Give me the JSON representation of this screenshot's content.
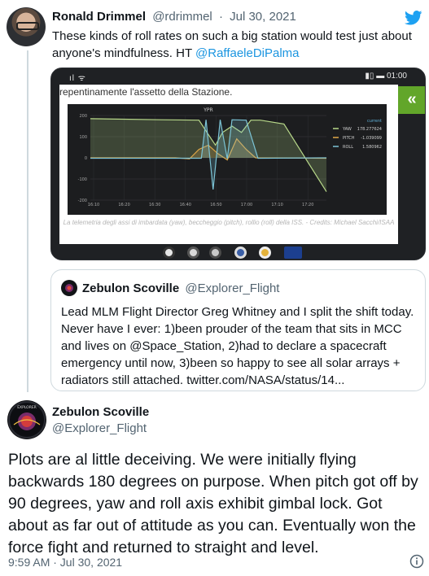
{
  "reply_tweet": {
    "author_name": "Ronald Drimmel",
    "handle": "@rdrimmel",
    "separator": "·",
    "date": "Jul 30, 2021",
    "text_before": "These kinds of roll rates on such a big station would test just about anyone's mindfulness. HT ",
    "mention": "@RaffaeleDiPalma",
    "icons": {
      "avatar": "avatar",
      "platform": "bird-icon"
    },
    "media": {
      "status_left": "ıl ᯤ",
      "status_right": "▮▯ ▬ 01:00",
      "page_text": "repentinamente l'assetto della Stazione.",
      "caption": "La telemetria degli assi di imbardata (yaw), beccheggio (pitch), rollio (roll) della ISS. - Credits: Michael Sacchi/ISAA",
      "nav_button": "«",
      "chart_data": {
        "type": "line",
        "title": "YPR",
        "x": [
          "16:10",
          "16:20",
          "16:30",
          "16:40",
          "16:50",
          "17:00",
          "17:10",
          "17:20"
        ],
        "ylim": [
          -200,
          200
        ],
        "yticks": [
          "200",
          "100",
          "0",
          "-100",
          "-200"
        ],
        "legend_header": "current",
        "legend_position": "right",
        "series": [
          {
            "name": "YAW",
            "current": "178.277624",
            "color": "#b8d98a",
            "points": [
              [
                0,
                185
              ],
              [
                0.3,
                180
              ],
              [
                0.46,
                178
              ],
              [
                0.5,
                110
              ],
              [
                0.53,
                60
              ],
              [
                0.56,
                120
              ],
              [
                0.6,
                150
              ],
              [
                0.64,
                120
              ],
              [
                0.68,
                178
              ],
              [
                0.72,
                178
              ],
              [
                0.82,
                160
              ],
              [
                1,
                -160
              ]
            ]
          },
          {
            "name": "PITCH",
            "current": "-1.039099",
            "color": "#e0a848",
            "points": [
              [
                0,
                0
              ],
              [
                0.36,
                0
              ],
              [
                0.42,
                -5
              ],
              [
                0.46,
                40
              ],
              [
                0.5,
                60
              ],
              [
                0.54,
                20
              ],
              [
                0.58,
                -10
              ],
              [
                0.62,
                90
              ],
              [
                0.66,
                40
              ],
              [
                0.7,
                0
              ],
              [
                1,
                -2
              ]
            ]
          },
          {
            "name": "ROLL",
            "current": "1.580962",
            "color": "#7cc4d6",
            "points": [
              [
                0,
                -2
              ],
              [
                0.47,
                -2
              ],
              [
                0.49,
                180
              ],
              [
                0.52,
                -150
              ],
              [
                0.55,
                180
              ],
              [
                0.58,
                -5
              ],
              [
                0.6,
                180
              ],
              [
                0.66,
                178
              ],
              [
                0.71,
                -2
              ],
              [
                1,
                0
              ]
            ]
          }
        ]
      },
      "bottom_icons": [
        "nasa-logo-icon",
        "agency-patch-icon",
        "crew-patch-icon",
        "mission-patch-icon",
        "esa-patch-icon",
        "flag-icon"
      ]
    }
  },
  "quoted_tweet": {
    "author_name": "Zebulon Scoville",
    "handle": "@Explorer_Flight",
    "text": "Lead MLM Flight Director Greg Whitney and I split the shift today. Never have I ever: 1)been prouder of the team that sits in MCC and lives on @Space_Station, 2)had to declare a spacecraft emergency until now, 3)been so happy to see all solar arrays + radiators still attached. twitter.com/NASA/status/14..."
  },
  "main_tweet": {
    "author_name": "Zebulon Scoville",
    "handle": "@Explorer_Flight",
    "text": "Plots are al little deceiving. We were initially flying backwards 180 degrees on purpose. When pitch got  off by 90 degrees, yaw and roll axis exhibit gimbal lock. Got about as far out of attitude as you can. Eventually won the force fight and returned to straight and level.",
    "timestamp": "9:59 AM · Jul 30, 2021",
    "avatar_patch_text": "EXPLORER"
  }
}
